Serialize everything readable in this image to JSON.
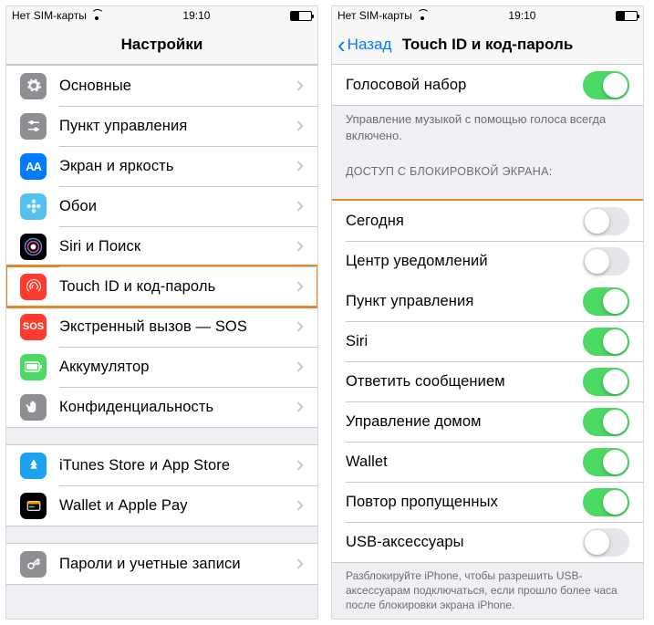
{
  "status": {
    "carrier": "Нет SIM-карты",
    "time": "19:10"
  },
  "left": {
    "title": "Настройки",
    "g1": [
      {
        "t": "Основные",
        "i": "gear",
        "c": "#8e8e93"
      },
      {
        "t": "Пункт управления",
        "i": "sliders",
        "c": "#8e8e93"
      },
      {
        "t": "Экран и яркость",
        "i": "aa",
        "c": "#007aff"
      },
      {
        "t": "Обои",
        "i": "flower",
        "c": "#55c1ef"
      },
      {
        "t": "Siri и Поиск",
        "i": "siri",
        "c": "#000"
      },
      {
        "t": "Touch ID и код-пароль",
        "i": "finger",
        "c": "#ff3b30",
        "hl": true
      },
      {
        "t": "Экстренный вызов — SOS",
        "i": "sos",
        "c": "#ff3b30"
      },
      {
        "t": "Аккумулятор",
        "i": "batt",
        "c": "#4cd964"
      },
      {
        "t": "Конфиденциальность",
        "i": "hand",
        "c": "#8e8e93"
      }
    ],
    "g2": [
      {
        "t": "iTunes Store и App Store",
        "i": "astore",
        "c": "#1da1f2"
      },
      {
        "t": "Wallet и Apple Pay",
        "i": "wallet",
        "c": "#000"
      }
    ],
    "g3": [
      {
        "t": "Пароли и учетные записи",
        "i": "key",
        "c": "#8e8e93"
      }
    ]
  },
  "right": {
    "back": "Назад",
    "title": "Touch ID и код-пароль",
    "voice_label": "Голосовой набор",
    "voice_on": true,
    "voice_note": "Управление музыкой с помощью голоса всегда включено.",
    "lock_header": "ДОСТУП С БЛОКИРОВКОЙ ЭКРАНА:",
    "rows": [
      {
        "t": "Сегодня",
        "on": false,
        "hl": true
      },
      {
        "t": "Центр уведомлений",
        "on": false,
        "hl": true
      },
      {
        "t": "Пункт управления",
        "on": true
      },
      {
        "t": "Siri",
        "on": true
      },
      {
        "t": "Ответить сообщением",
        "on": true
      },
      {
        "t": "Управление домом",
        "on": true
      },
      {
        "t": "Wallet",
        "on": true
      },
      {
        "t": "Повтор пропущенных",
        "on": true
      },
      {
        "t": "USB-аксессуары",
        "on": false
      }
    ],
    "footer": "Разблокируйте iPhone, чтобы разрешить USB-аксессуарам подключаться, если прошло более часа после блокировки экрана iPhone."
  },
  "colors": {
    "hl": "#e08730"
  }
}
